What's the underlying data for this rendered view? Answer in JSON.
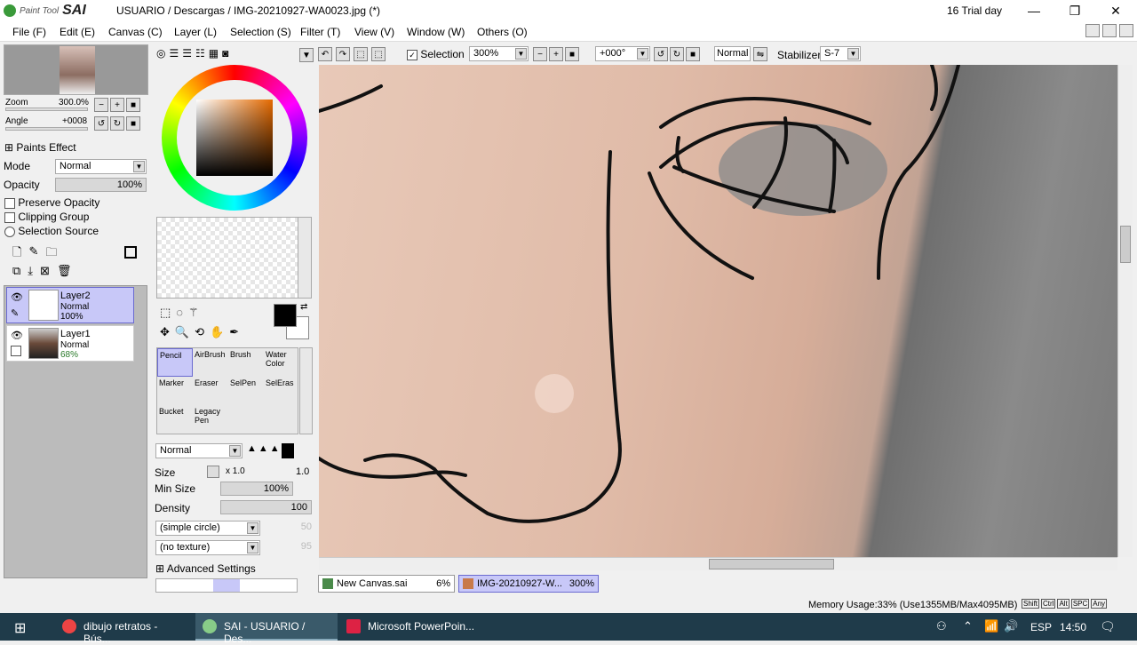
{
  "app": {
    "logo_small": "Paint Tool",
    "logo_big": "SAI",
    "title": "USUARIO / Descargas / IMG-20210927-WA0023.jpg (*)",
    "trial": "16 Trial day"
  },
  "window_controls": {
    "minimize": "—",
    "restore": "❐",
    "close": "✕"
  },
  "menu": [
    "File (F)",
    "Edit (E)",
    "Canvas (C)",
    "Layer (L)",
    "Selection (S)",
    "Filter (T)",
    "View (V)",
    "Window (W)",
    "Others (O)"
  ],
  "navigator": {
    "zoom_label": "Zoom",
    "zoom_value": "300.0%",
    "angle_label": "Angle",
    "angle_value": "+0008"
  },
  "layer_props": {
    "paints_effect": "Paints Effect",
    "mode_label": "Mode",
    "mode_value": "Normal",
    "opacity_label": "Opacity",
    "opacity_value": "100%",
    "preserve_opacity": "Preserve Opacity",
    "clipping_group": "Clipping Group",
    "selection_source": "Selection Source"
  },
  "layers": [
    {
      "name": "Layer2",
      "mode": "Normal",
      "opacity": "100%"
    },
    {
      "name": "Layer1",
      "mode": "Normal",
      "opacity": "68%"
    }
  ],
  "brushes": [
    "Pencil",
    "AirBrush",
    "Brush",
    "Water Color",
    "Marker",
    "Eraser",
    "SelPen",
    "SelEras",
    "Bucket",
    "Legacy Pen"
  ],
  "brush_settings": {
    "mode": "Normal",
    "size_label": "Size",
    "size_mult": "x 1.0",
    "size_value": "1.0",
    "minsize_label": "Min Size",
    "minsize_value": "100%",
    "density_label": "Density",
    "density_value": "100",
    "shape": "(simple circle)",
    "shape_value": "50",
    "texture": "(no texture)",
    "texture_value": "95",
    "advanced": "Advanced Settings"
  },
  "toolbar": {
    "selection": "Selection",
    "zoom": "300%",
    "angle": "+000°",
    "blend": "Normal",
    "stabilizer_label": "Stabilizer",
    "stabilizer_value": "S-7"
  },
  "tabs": [
    {
      "name": "New Canvas.sai",
      "zoom": "6%"
    },
    {
      "name": "IMG-20210927-W...",
      "zoom": "300%"
    }
  ],
  "status": {
    "memory": "Memory Usage:33% (Use1355MB/Max4095MB)",
    "keys": [
      "Shift",
      "Ctrl",
      "Alt",
      "SPC",
      "Any"
    ]
  },
  "taskbar": {
    "items": [
      "dibujo retratos - Bús...",
      "SAI - USUARIO / Des...",
      "Microsoft PowerPoin..."
    ],
    "lang": "ESP",
    "time": "14:50"
  },
  "colors": {
    "accent": "#c8c8f8",
    "taskbar": "#1f3b4a"
  }
}
